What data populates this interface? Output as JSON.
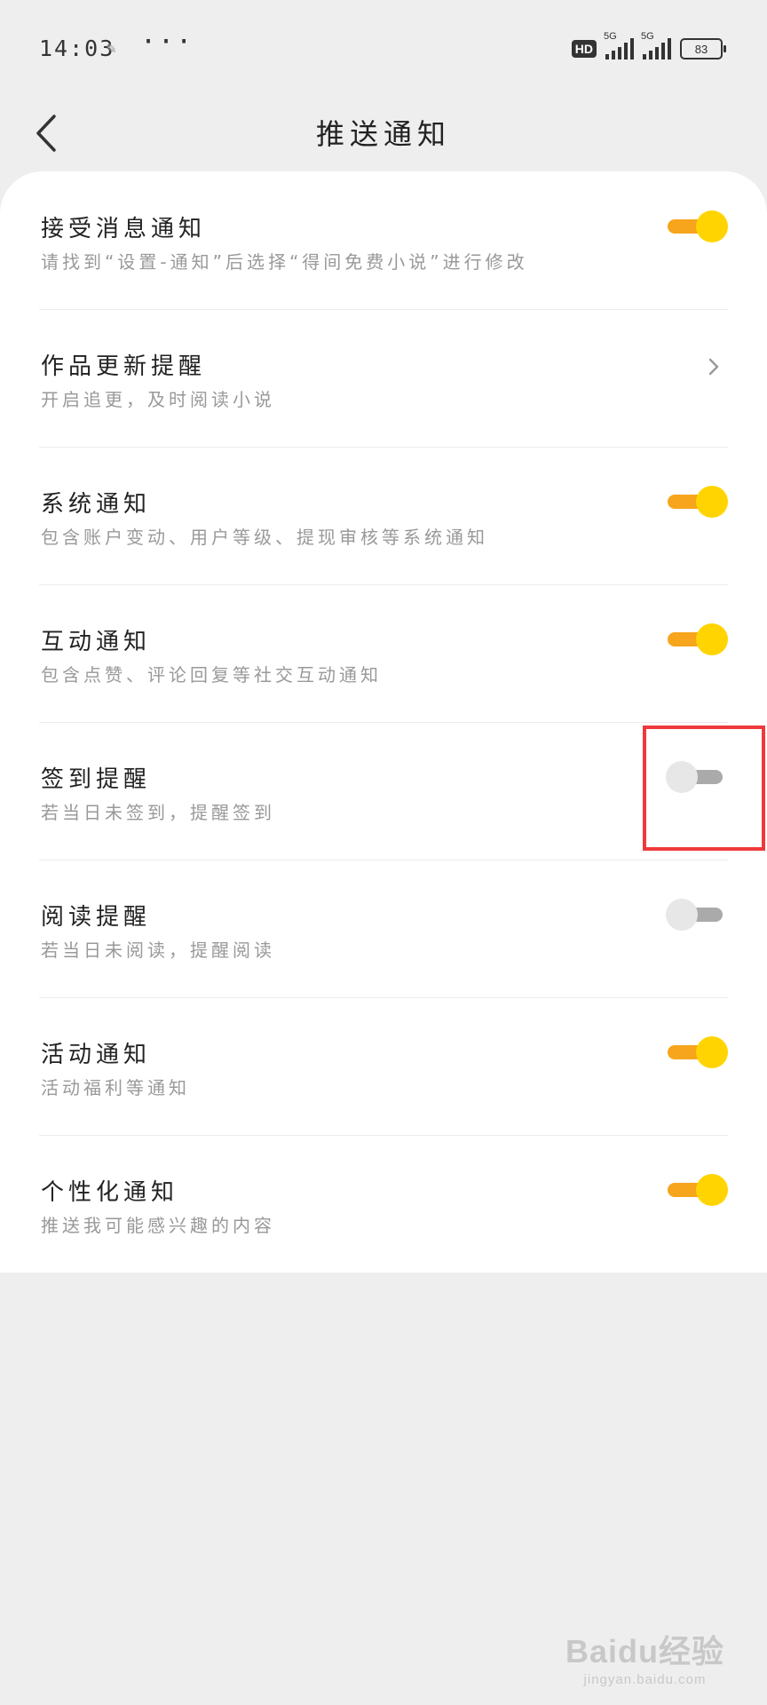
{
  "status_bar": {
    "time": "14:03",
    "network": "5G",
    "hd_label": "HD",
    "battery": "83"
  },
  "header": {
    "title": "推送通知"
  },
  "settings": [
    {
      "title": "接受消息通知",
      "desc": "请找到“设置-通知”后选择“得间免费小说”进行修改",
      "control": "toggle",
      "on": true
    },
    {
      "title": "作品更新提醒",
      "desc": "开启追更，及时阅读小说",
      "control": "chevron"
    },
    {
      "title": "系统通知",
      "desc": "包含账户变动、用户等级、提现审核等系统通知",
      "control": "toggle",
      "on": true
    },
    {
      "title": "互动通知",
      "desc": "包含点赞、评论回复等社交互动通知",
      "control": "toggle",
      "on": true
    },
    {
      "title": "签到提醒",
      "desc": "若当日未签到，提醒签到",
      "control": "toggle",
      "on": false,
      "highlighted": true
    },
    {
      "title": "阅读提醒",
      "desc": "若当日未阅读，提醒阅读",
      "control": "toggle",
      "on": false
    },
    {
      "title": "活动通知",
      "desc": "活动福利等通知",
      "control": "toggle",
      "on": true
    },
    {
      "title": "个性化通知",
      "desc": "推送我可能感兴趣的内容",
      "control": "toggle",
      "on": true
    }
  ],
  "watermark": {
    "main": "Baidu经验",
    "sub": "jingyan.baidu.com"
  },
  "colors": {
    "toggle_on_track": "#f7a51c",
    "toggle_on_knob": "#ffd400",
    "toggle_off_track": "#aaaaaa",
    "highlight": "#ee3a3a"
  }
}
